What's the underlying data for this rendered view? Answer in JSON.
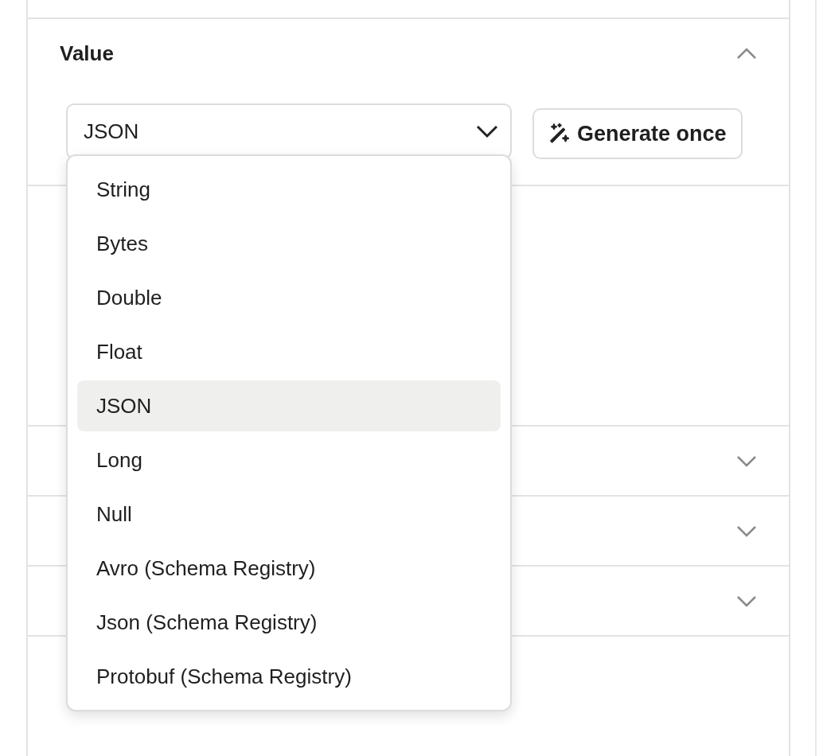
{
  "value_section": {
    "title": "Value",
    "expanded": true,
    "select": {
      "value": "JSON",
      "open": true,
      "options": [
        {
          "label": "String",
          "selected": false
        },
        {
          "label": "Bytes",
          "selected": false
        },
        {
          "label": "Double",
          "selected": false
        },
        {
          "label": "Float",
          "selected": false
        },
        {
          "label": "JSON",
          "selected": true
        },
        {
          "label": "Long",
          "selected": false
        },
        {
          "label": "Null",
          "selected": false
        },
        {
          "label": "Avro (Schema Registry)",
          "selected": false
        },
        {
          "label": "Json (Schema Registry)",
          "selected": false
        },
        {
          "label": "Protobuf (Schema Registry)",
          "selected": false
        }
      ]
    },
    "generate_button": "Generate once"
  },
  "other_sections": [
    {
      "expanded": false
    },
    {
      "expanded": false
    },
    {
      "expanded": false
    }
  ]
}
